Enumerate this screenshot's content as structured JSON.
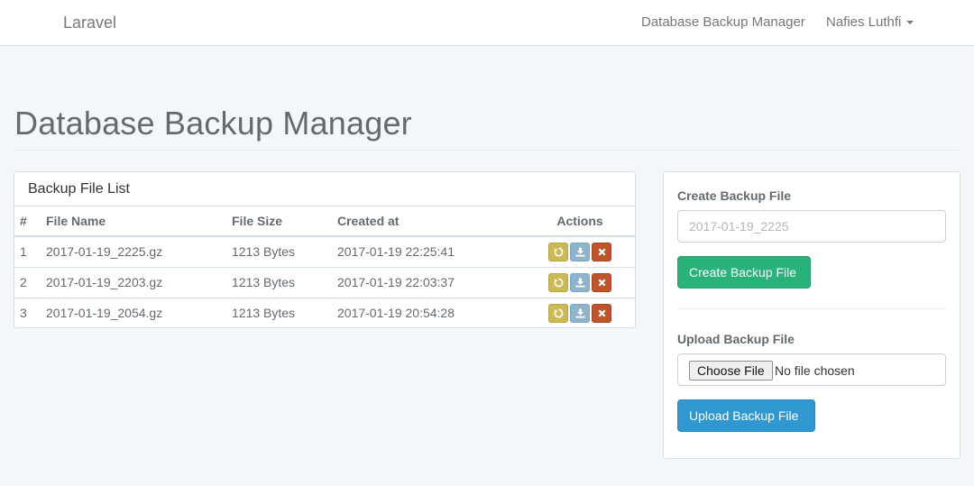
{
  "navbar": {
    "brand": "Laravel",
    "link_backup": "Database Backup Manager",
    "user_name": "Nafies Luthfi"
  },
  "page": {
    "title": "Database Backup Manager"
  },
  "backup_list": {
    "heading": "Backup File List",
    "columns": {
      "num": "#",
      "file_name": "File Name",
      "file_size": "File Size",
      "created_at": "Created at",
      "actions": "Actions"
    },
    "rows": [
      {
        "num": "1",
        "file_name": "2017-01-19_2225.gz",
        "file_size": "1213 Bytes",
        "created_at": "2017-01-19 22:25:41"
      },
      {
        "num": "2",
        "file_name": "2017-01-19_2203.gz",
        "file_size": "1213 Bytes",
        "created_at": "2017-01-19 22:03:37"
      },
      {
        "num": "3",
        "file_name": "2017-01-19_2054.gz",
        "file_size": "1213 Bytes",
        "created_at": "2017-01-19 20:54:28"
      }
    ],
    "action_icons": [
      "refresh-icon",
      "download-icon",
      "close-icon"
    ]
  },
  "create_form": {
    "label": "Create Backup File",
    "input_placeholder": "2017-01-19_2225",
    "input_value": "",
    "button_label": "Create Backup File"
  },
  "upload_form": {
    "label": "Upload Backup File",
    "choose_label": "Choose File",
    "no_file_text": "No file chosen",
    "button_label": "Upload Backup File"
  },
  "colors": {
    "restore": "#cbb956",
    "download": "#8eb4cb",
    "delete": "#bf5329",
    "create_button": "#2ab27b",
    "upload_button": "#3097d1"
  }
}
